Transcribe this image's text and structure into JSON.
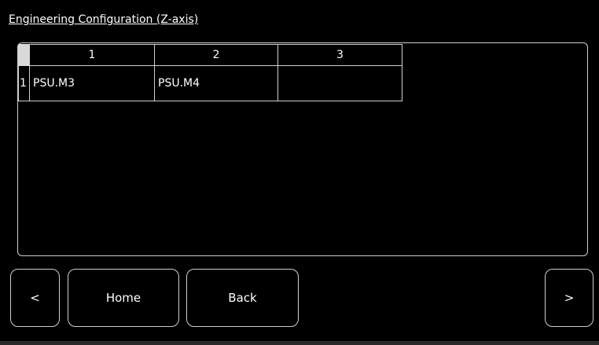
{
  "title": "Engineering Configuration (Z-axis)",
  "table": {
    "columns": [
      "1",
      "2",
      "3"
    ],
    "rows": [
      {
        "header": "1",
        "cells": [
          "PSU.M3",
          "PSU.M4",
          ""
        ]
      }
    ]
  },
  "buttons": {
    "prev": "<",
    "home": "Home",
    "back": "Back",
    "next": ">"
  }
}
